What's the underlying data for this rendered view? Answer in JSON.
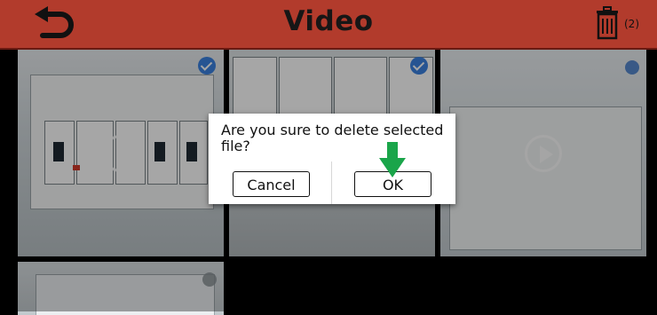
{
  "header": {
    "title": "Video",
    "back_icon": "back-arrow-icon",
    "delete_icon": "trash-icon",
    "selected_count": "(2)",
    "bar_color": "#b23b2c"
  },
  "thumbnails": [
    {
      "selected": true
    },
    {
      "selected": true
    },
    {
      "selected": false
    },
    {
      "selected": false
    }
  ],
  "dialog": {
    "message": "Are you sure to delete selected file?",
    "cancel_label": "Cancel",
    "ok_label": "OK"
  },
  "hint_arrow": {
    "icon": "down-arrow-icon",
    "color": "#1aa54a"
  }
}
